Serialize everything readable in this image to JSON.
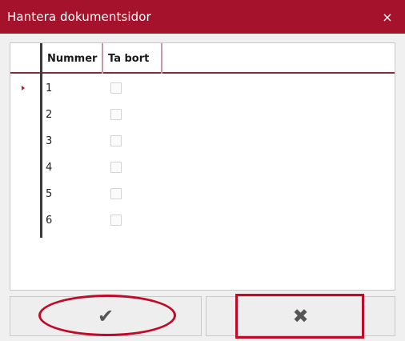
{
  "window": {
    "title": "Hantera dokumentsidor",
    "close_icon": "×"
  },
  "grid": {
    "columns": [
      "Nummer",
      "Ta bort"
    ],
    "current_row_index": 0,
    "rows": [
      {
        "nummer": "1",
        "ta_bort": false
      },
      {
        "nummer": "2",
        "ta_bort": false
      },
      {
        "nummer": "3",
        "ta_bort": false
      },
      {
        "nummer": "4",
        "ta_bort": false
      },
      {
        "nummer": "5",
        "ta_bort": false
      },
      {
        "nummer": "6",
        "ta_bort": false
      }
    ]
  },
  "buttons": {
    "ok_icon": "✔",
    "cancel_icon": "✖"
  },
  "colors": {
    "titlebar": "#a4122b",
    "annotation": "#c00a2a"
  }
}
